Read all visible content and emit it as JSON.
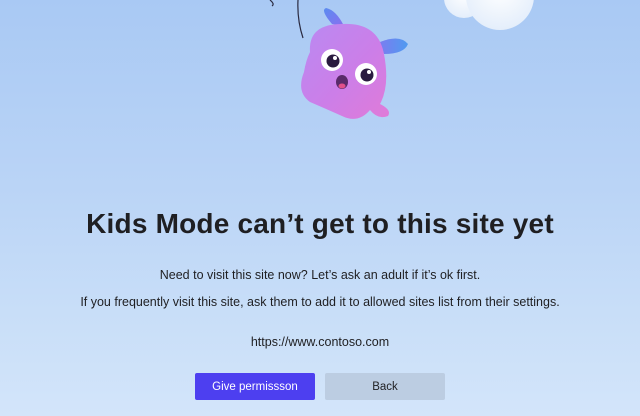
{
  "page": {
    "title": "Kids Mode can’t get to this site yet",
    "message_1": "Need to visit this site now? Let’s ask an adult if it’s ok first.",
    "message_2": "If you frequently visit this site, ask them to add it to allowed sites list from their settings.",
    "url": "https://www.contoso.com"
  },
  "buttons": {
    "give_permission": "Give permissson",
    "back": "Back"
  },
  "illustration": {
    "mascot": "kite-mascot-icon",
    "cloud": "cloud-icon"
  },
  "colors": {
    "primary_button": "#4d3ff0",
    "secondary_button": "#bccde2",
    "mascot_body": "#c77df0",
    "background_top": "#a9c9f4",
    "background_bottom": "#d3e5fa"
  }
}
